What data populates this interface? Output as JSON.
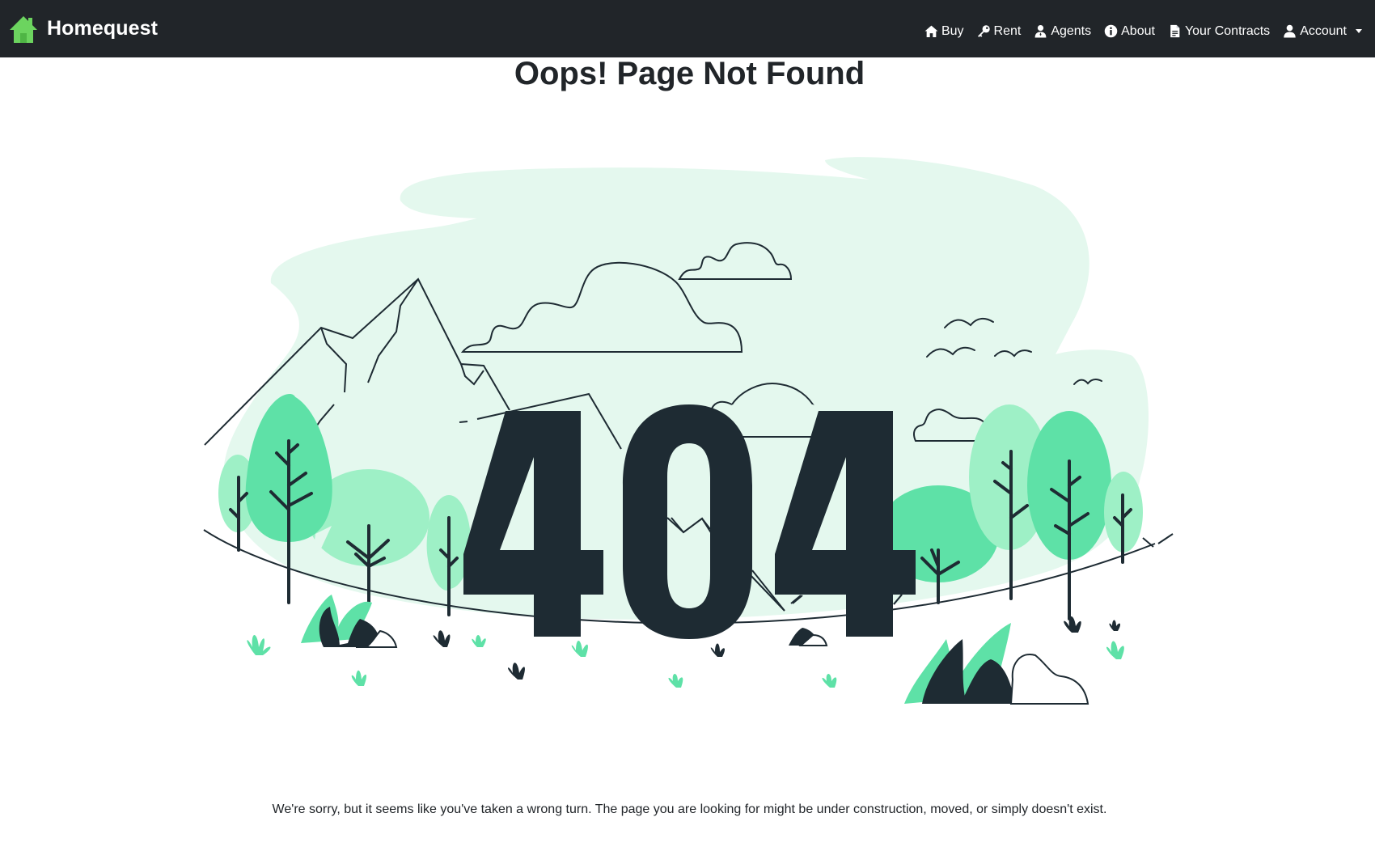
{
  "header": {
    "brand": {
      "name": "Homequest",
      "logo_icon": "house-icon",
      "accent_color": "#6cd45f"
    },
    "nav": [
      {
        "id": "buy",
        "label": "Buy",
        "icon": "home-icon"
      },
      {
        "id": "rent",
        "label": "Rent",
        "icon": "key-icon"
      },
      {
        "id": "agents",
        "label": "Agents",
        "icon": "agent-icon"
      },
      {
        "id": "about",
        "label": "About",
        "icon": "info-circle-icon"
      },
      {
        "id": "contracts",
        "label": "Your Contracts",
        "icon": "document-icon"
      },
      {
        "id": "account",
        "label": "Account",
        "icon": "user-icon",
        "dropdown": true
      }
    ]
  },
  "main": {
    "title": "Oops! Page Not Found",
    "illustration": {
      "code": "404",
      "palette": {
        "dark": "#1e2b33",
        "green": "#5ee1a7",
        "light_green": "#9ef0c6",
        "mint": "#e4f8ee"
      }
    },
    "message": "We're sorry, but it seems like you've taken a wrong turn. The page you are looking for might be under construction, moved, or simply doesn't exist."
  }
}
